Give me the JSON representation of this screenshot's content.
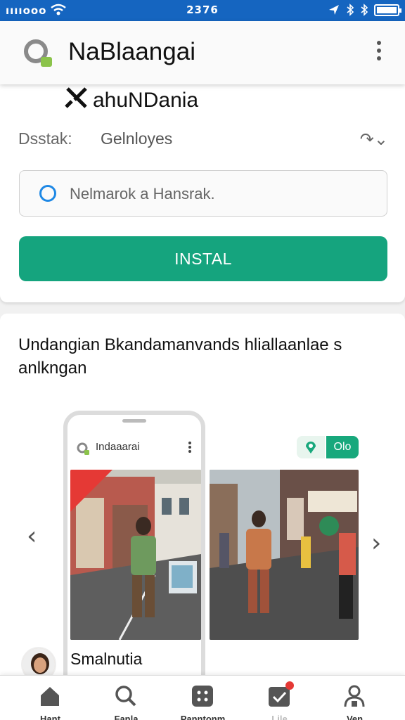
{
  "status_bar": {
    "signal": "ııııooo",
    "time": "2376",
    "battery_level": 1.0
  },
  "app_bar": {
    "title": "NaBlaangai"
  },
  "header_card": {
    "subheader": "ahuNDania",
    "row_label": "Dsstak:",
    "row_value": "Gelnloyes",
    "row_icon": "↷⌄",
    "search_placeholder": "Nelmarok a Hansrak.",
    "install_label": "INSTAL"
  },
  "content_card": {
    "description": "Undangian Bkandamanvands hliallaanlae s anlkngan",
    "phone_title": "Indaaarai",
    "chip_label": "Olo",
    "author_name": "Smalnutia"
  },
  "bottom_nav": {
    "items": [
      {
        "label": "Hant",
        "icon": "home-icon"
      },
      {
        "label": "Fanla",
        "icon": "search-icon"
      },
      {
        "label": "Panntonm",
        "icon": "apps-icon"
      },
      {
        "label": "Lile",
        "icon": "inbox-icon"
      },
      {
        "label": "Ven",
        "icon": "profile-icon"
      }
    ]
  },
  "colors": {
    "accent": "#15a47e",
    "status_bar": "#1565c0",
    "link": "#1e88e5"
  }
}
